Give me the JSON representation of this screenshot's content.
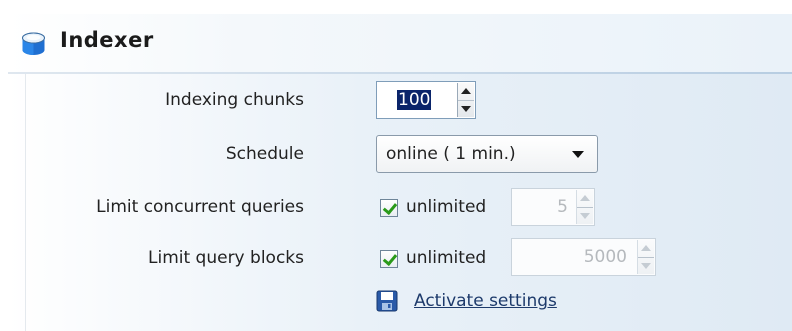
{
  "section": {
    "title": "Indexer",
    "icon": "database-icon"
  },
  "fields": {
    "indexing_chunks": {
      "label": "Indexing chunks",
      "value": "100"
    },
    "schedule": {
      "label": "Schedule",
      "selected": "online ( 1 min.)"
    },
    "limit_concurrent_queries": {
      "label": "Limit concurrent queries",
      "checkbox_label": "unlimited",
      "checked": true,
      "value": "5"
    },
    "limit_query_blocks": {
      "label": "Limit query blocks",
      "checkbox_label": "unlimited",
      "checked": true,
      "value": "5000"
    }
  },
  "actions": {
    "activate_label": "Activate settings",
    "activate_icon": "save-icon"
  },
  "colors": {
    "panel_blue": "#dfeaf4",
    "link": "#1d3a6b",
    "check": "#2a9a1a",
    "selection": "#0a246a"
  }
}
